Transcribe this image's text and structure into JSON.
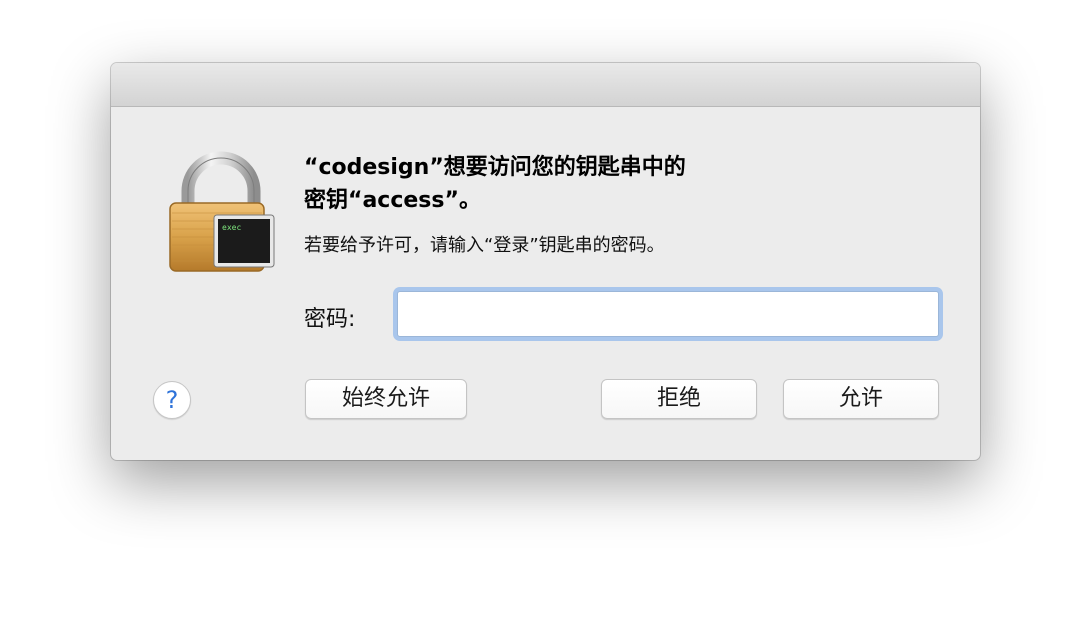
{
  "dialog": {
    "title_line1": "“codesign”想要访问您的钥匙串中的",
    "title_line2": "密钥“access”。",
    "subtitle": "若要给予许可，请输入“登录”钥匙串的密码。",
    "icon": "lock-exec-icon",
    "icon_text": "exec"
  },
  "password": {
    "label": "密码:",
    "value": "",
    "placeholder": ""
  },
  "buttons": {
    "help": "?",
    "always_allow": "始终允许",
    "deny": "拒绝",
    "allow": "允许"
  },
  "colors": {
    "window_bg": "#ececec",
    "focus_ring": "#a9c6ec",
    "help_blue": "#2d72d9",
    "lock_gold": "#d9a24a",
    "terminal_text": "#7ce37c"
  }
}
